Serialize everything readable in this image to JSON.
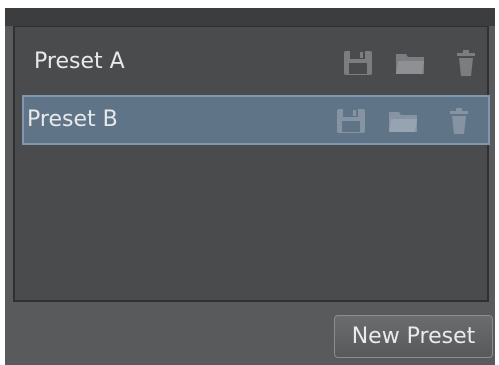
{
  "presets": [
    {
      "name": "Preset A",
      "selected": false,
      "icons": [
        "save-icon",
        "folder-icon",
        "trash-icon"
      ]
    },
    {
      "name": "Preset B",
      "selected": true,
      "icons": [
        "save-icon",
        "folder-icon",
        "trash-icon"
      ]
    }
  ],
  "footer": {
    "new_preset_label": "New Preset"
  },
  "colors": {
    "panel_bg": "#4a4b4d",
    "frame_bg": "#595a5b",
    "selected_bg": "#607488",
    "selected_border": "#8297ad",
    "text": "#e6e8ea",
    "icon": "#7b7d80"
  }
}
